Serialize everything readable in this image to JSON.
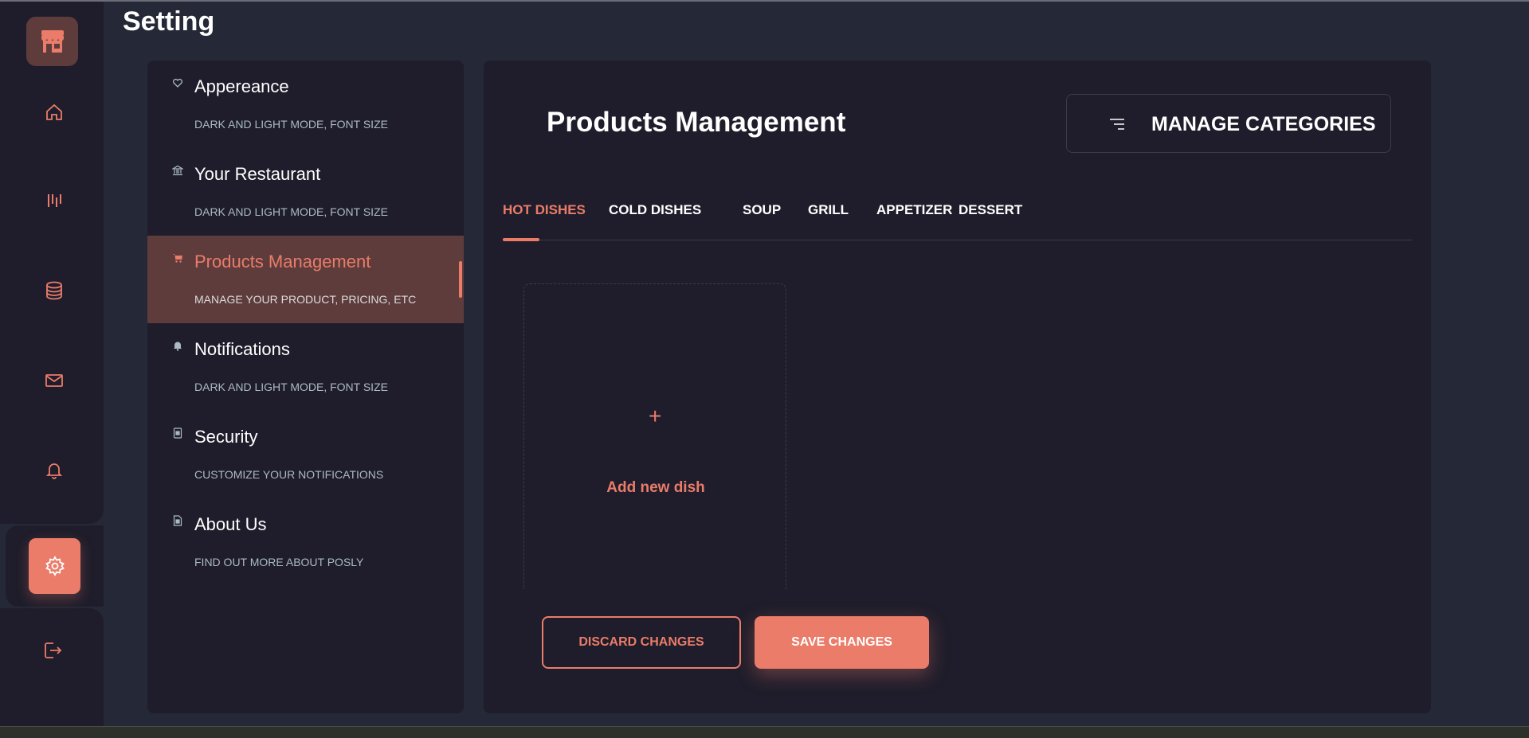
{
  "page": {
    "title": "Setting"
  },
  "colors": {
    "accent": "#ea7c69",
    "background": "#252836",
    "surface": "#1f1d2b",
    "active_bg": "#5e3c3c",
    "muted_text": "#abbbc2"
  },
  "rail": {
    "icons": [
      "store-logo-icon",
      "home-icon",
      "discount-icon",
      "database-icon",
      "mail-icon",
      "bell-icon",
      "gear-icon",
      "logout-icon"
    ]
  },
  "menu": {
    "items": [
      {
        "title": "Appereance",
        "subtitle": "DARK AND LIGHT MODE, FONT SIZE",
        "icon": "heart-icon"
      },
      {
        "title": "Your Restaurant",
        "subtitle": "DARK AND LIGHT MODE, FONT SIZE",
        "icon": "bank-icon"
      },
      {
        "title": "Products Management",
        "subtitle": "MANAGE YOUR PRODUCT, PRICING, ETC",
        "icon": "cart-icon"
      },
      {
        "title": "Notifications",
        "subtitle": "DARK AND LIGHT MODE, FONT SIZE",
        "icon": "bell-icon"
      },
      {
        "title": "Security",
        "subtitle": "CUSTOMIZE YOUR NOTIFICATIONS",
        "icon": "lock-icon"
      },
      {
        "title": "About Us",
        "subtitle": "FIND OUT MORE ABOUT POSLY",
        "icon": "document-icon"
      }
    ]
  },
  "main": {
    "title": "Products Management",
    "manage_label": "MANAGE CATEGORIES",
    "tabs": [
      {
        "label": "HOT DISHES"
      },
      {
        "label": "COLD DISHES"
      },
      {
        "label": "SOUP"
      },
      {
        "label": "GRILL"
      },
      {
        "label": "APPETIZER"
      },
      {
        "label": "DESSERT"
      }
    ],
    "add_card": {
      "plus": "+",
      "label": "Add new dish"
    },
    "discard_label": "DISCARD CHANGES",
    "save_label": "SAVE CHANGES"
  }
}
